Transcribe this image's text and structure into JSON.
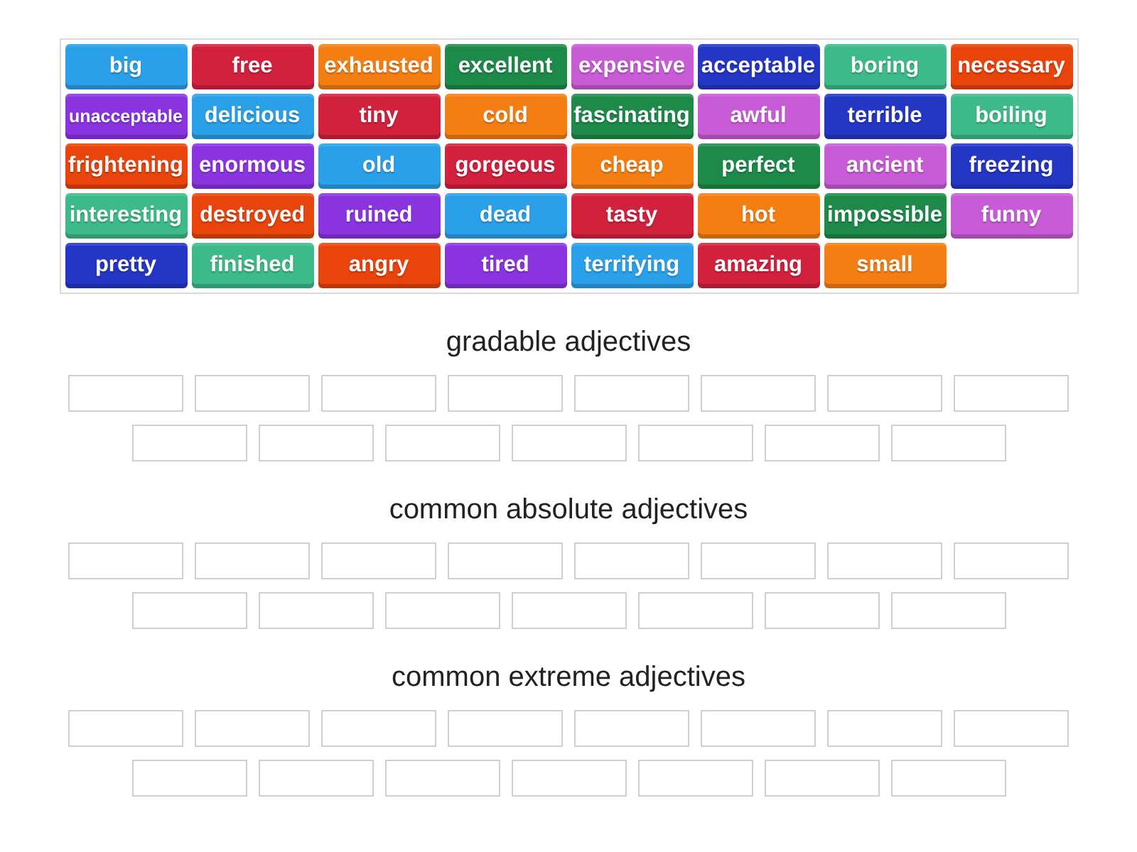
{
  "word_bank": {
    "tiles": [
      {
        "text": "big",
        "color": "#2aa0e8"
      },
      {
        "text": "free",
        "color": "#d2213c"
      },
      {
        "text": "exhausted",
        "color": "#f57e12"
      },
      {
        "text": "excellent",
        "color": "#1d8a49"
      },
      {
        "text": "expensive",
        "color": "#c85bd6"
      },
      {
        "text": "acceptable",
        "color": "#2436c4"
      },
      {
        "text": "boring",
        "color": "#3dba8a"
      },
      {
        "text": "necessary",
        "color": "#e8440c"
      },
      {
        "text": "unacceptable",
        "color": "#8a34e0"
      },
      {
        "text": "delicious",
        "color": "#2aa0e8"
      },
      {
        "text": "tiny",
        "color": "#d2213c"
      },
      {
        "text": "cold",
        "color": "#f57e12"
      },
      {
        "text": "fascinating",
        "color": "#1d8a49"
      },
      {
        "text": "awful",
        "color": "#c85bd6"
      },
      {
        "text": "terrible",
        "color": "#2436c4"
      },
      {
        "text": "boiling",
        "color": "#3dba8a"
      },
      {
        "text": "frightening",
        "color": "#e8440c"
      },
      {
        "text": "enormous",
        "color": "#8a34e0"
      },
      {
        "text": "old",
        "color": "#2aa0e8"
      },
      {
        "text": "gorgeous",
        "color": "#d2213c"
      },
      {
        "text": "cheap",
        "color": "#f57e12"
      },
      {
        "text": "perfect",
        "color": "#1d8a49"
      },
      {
        "text": "ancient",
        "color": "#c85bd6"
      },
      {
        "text": "freezing",
        "color": "#2436c4"
      },
      {
        "text": "interesting",
        "color": "#3dba8a"
      },
      {
        "text": "destroyed",
        "color": "#e8440c"
      },
      {
        "text": "ruined",
        "color": "#8a34e0"
      },
      {
        "text": "dead",
        "color": "#2aa0e8"
      },
      {
        "text": "tasty",
        "color": "#d2213c"
      },
      {
        "text": "hot",
        "color": "#f57e12"
      },
      {
        "text": "impossible",
        "color": "#1d8a49"
      },
      {
        "text": "funny",
        "color": "#c85bd6"
      },
      {
        "text": "pretty",
        "color": "#2436c4"
      },
      {
        "text": "finished",
        "color": "#3dba8a"
      },
      {
        "text": "angry",
        "color": "#e8440c"
      },
      {
        "text": "tired",
        "color": "#8a34e0"
      },
      {
        "text": "terrifying",
        "color": "#2aa0e8"
      },
      {
        "text": "amazing",
        "color": "#d2213c"
      },
      {
        "text": "small",
        "color": "#f57e12"
      }
    ]
  },
  "groups": [
    {
      "title": "gradable adjectives",
      "boxes": [
        {
          "filled": false
        },
        {
          "filled": false
        },
        {
          "filled": false
        },
        {
          "filled": false
        },
        {
          "filled": false
        },
        {
          "filled": false
        },
        {
          "filled": false
        },
        {
          "filled": false
        },
        {
          "filled": false
        },
        {
          "filled": false
        },
        {
          "filled": false
        },
        {
          "filled": false
        },
        {
          "filled": false
        },
        {
          "filled": false
        },
        {
          "filled": false
        }
      ]
    },
    {
      "title": "common absolute adjectives",
      "boxes": [
        {
          "filled": false
        },
        {
          "filled": false
        },
        {
          "filled": false
        },
        {
          "filled": false
        },
        {
          "filled": false
        },
        {
          "filled": false
        },
        {
          "filled": false
        },
        {
          "filled": false
        },
        {
          "filled": false
        },
        {
          "filled": false
        },
        {
          "filled": false
        },
        {
          "filled": false
        },
        {
          "filled": false
        },
        {
          "filled": false
        },
        {
          "filled": false
        }
      ]
    },
    {
      "title": "common extreme adjectives",
      "boxes": [
        {
          "filled": false
        },
        {
          "filled": false
        },
        {
          "filled": false
        },
        {
          "filled": false
        },
        {
          "filled": false
        },
        {
          "filled": false
        },
        {
          "filled": false
        },
        {
          "filled": false
        },
        {
          "filled": false
        },
        {
          "filled": false
        },
        {
          "filled": false
        },
        {
          "filled": false
        },
        {
          "filled": false
        },
        {
          "filled": false
        },
        {
          "filled": false
        }
      ]
    }
  ]
}
